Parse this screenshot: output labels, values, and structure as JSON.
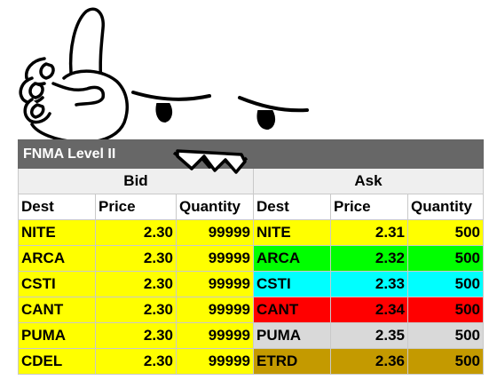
{
  "table": {
    "title": "FNMA Level II",
    "sides": {
      "bid": "Bid",
      "ask": "Ask"
    },
    "headers": {
      "bid": [
        "Dest",
        "Price",
        "Quantity"
      ],
      "ask": [
        "Dest",
        "Price",
        "Quantity"
      ]
    },
    "bid_color": "#ffff00",
    "rows": [
      {
        "bid": {
          "dest": "NITE",
          "price": "2.30",
          "qty": "99999"
        },
        "ask": {
          "dest": "NITE",
          "price": "2.31",
          "qty": "500",
          "color": "#ffff00"
        }
      },
      {
        "bid": {
          "dest": "ARCA",
          "price": "2.30",
          "qty": "99999"
        },
        "ask": {
          "dest": "ARCA",
          "price": "2.32",
          "qty": "500",
          "color": "#00ff00"
        }
      },
      {
        "bid": {
          "dest": "CSTI",
          "price": "2.30",
          "qty": "99999"
        },
        "ask": {
          "dest": "CSTI",
          "price": "2.33",
          "qty": "500",
          "color": "#00ffff"
        }
      },
      {
        "bid": {
          "dest": "CANT",
          "price": "2.30",
          "qty": "99999"
        },
        "ask": {
          "dest": "CANT",
          "price": "2.34",
          "qty": "500",
          "color": "#ff0000"
        }
      },
      {
        "bid": {
          "dest": "PUMA",
          "price": "2.30",
          "qty": "99999"
        },
        "ask": {
          "dest": "PUMA",
          "price": "2.35",
          "qty": "500",
          "color": "#d9d9d9"
        }
      },
      {
        "bid": {
          "dest": "CDEL",
          "price": "2.30",
          "qty": "99999"
        },
        "ask": {
          "dest": "ETRD",
          "price": "2.36",
          "qty": "500",
          "color": "#c49a00"
        }
      }
    ]
  },
  "cartoon": {
    "icons": [
      "pointing-hand-icon",
      "angry-eye-icon",
      "teeth-icon"
    ]
  }
}
